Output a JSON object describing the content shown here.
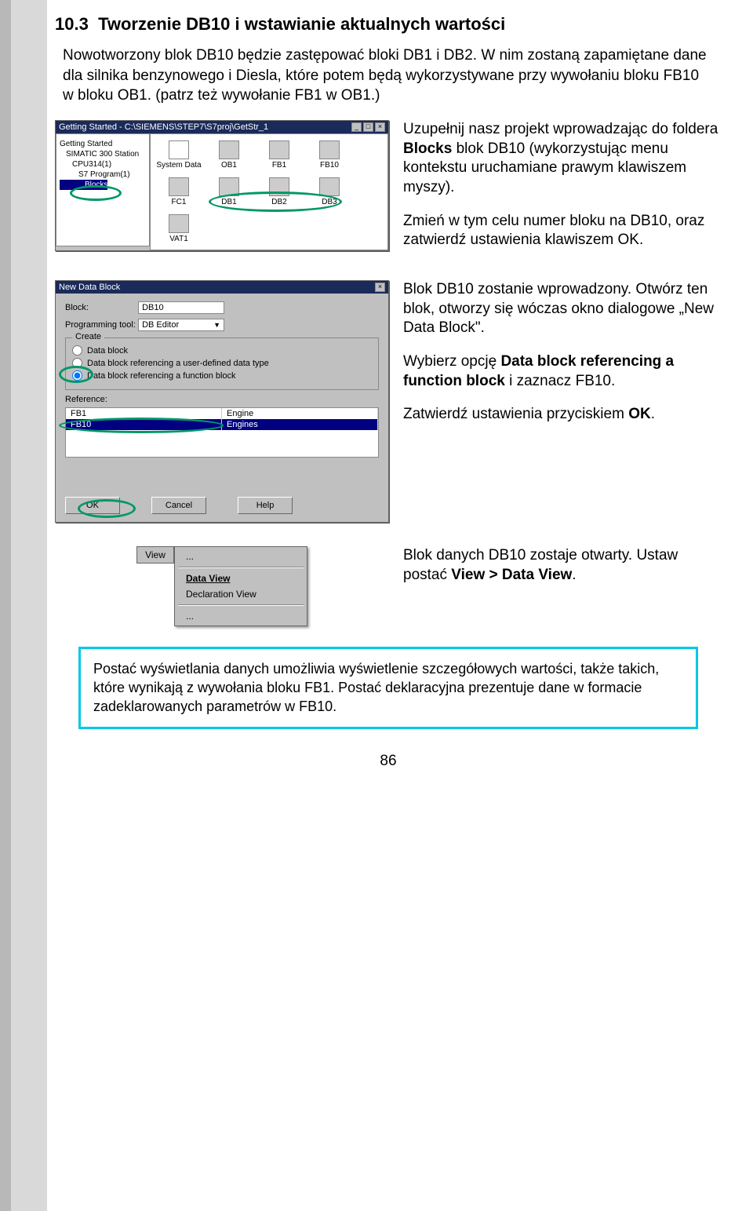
{
  "section": {
    "number": "10.3",
    "title": "Tworzenie DB10 i wstawianie aktualnych wartości"
  },
  "intro": "Nowotworzony blok DB10 będzie zastępować bloki DB1 i DB2. W nim zostaną zapamiętane dane dla silnika benzynowego i Diesla, które potem będą wykorzystywane przy wywołaniu bloku FB10 w bloku OB1. (patrz też wywołanie FB1 w OB1.)",
  "desc1a": "Uzupełnij nasz projekt wprowadzając do foldera Blocks blok DB10 (wykorzystując menu kontekstu uruchamiane prawym klawiszem myszy).",
  "desc1b": "Zmień w tym celu numer bloku na DB10, oraz zatwierdź ustawienia klawiszem OK.",
  "desc2a": "Blok DB10 zostanie wprowadzony. Otwórz ten blok, otworzy się wóczas okno dialogowe „New Data Block\".",
  "desc2b": "Wybierz opcję Data block referencing a function block i zaznacz FB10.",
  "desc2c": "Zatwierdź ustawienia przyciskiem OK.",
  "desc3a": "Blok danych DB10 zostaje otwarty. Ustaw postać View > Data View.",
  "note": "Postać wyświetlania danych umożliwia wyświetlenie szczegółowych wartości, także takich, które wynikają z wywołania bloku FB1. Postać deklaracyjna prezentuje dane w formacie zadeklarowanych parametrów w FB10.",
  "page_number": "86",
  "simatic": {
    "title": "Getting Started - C:\\SIEMENS\\STEP7\\S7proj\\GetStr_1",
    "tree": [
      "Getting Started",
      "SIMATIC 300 Station",
      "CPU314(1)",
      "S7 Program(1)",
      "Blocks"
    ],
    "icons_row1": [
      "System Data",
      "OB1",
      "FB1",
      "FB10"
    ],
    "icons_row2": [
      "FC1",
      "DB1",
      "DB2",
      "DB3"
    ],
    "icons_row3": [
      "VAT1"
    ]
  },
  "dlg": {
    "title": "New Data Block",
    "block_label": "Block:",
    "block_value": "DB10",
    "prog_label": "Programming tool:",
    "prog_value": "DB Editor",
    "group": "Create",
    "opt1": "Data block",
    "opt2": "Data block referencing a user-defined data type",
    "opt3": "Data block referencing a function block",
    "ref_label": "Reference:",
    "ref_rows": [
      {
        "a": "FB1",
        "b": "Engine"
      },
      {
        "a": "FB10",
        "b": "Engines"
      }
    ],
    "btn_ok": "OK",
    "btn_cancel": "Cancel",
    "btn_help": "Help"
  },
  "menu": {
    "header": "View",
    "items": [
      "...",
      "Data View",
      "Declaration View",
      "..."
    ]
  }
}
